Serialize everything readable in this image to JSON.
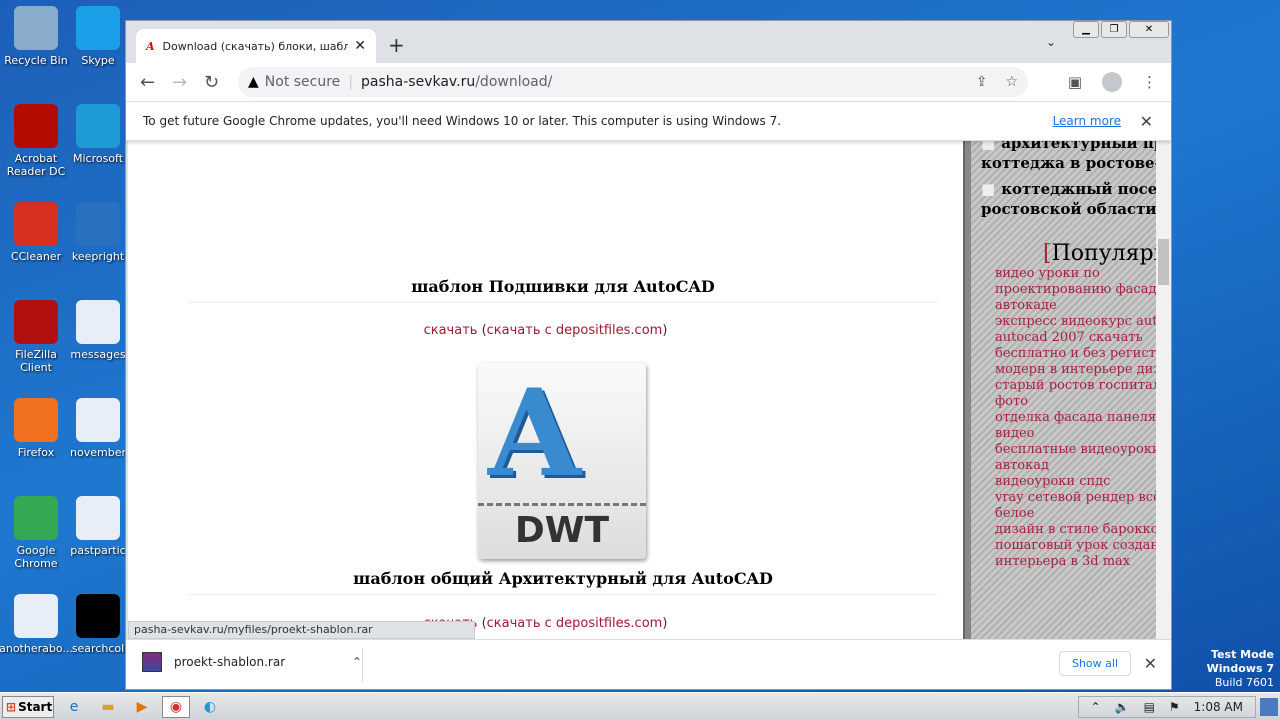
{
  "desktop": {
    "icons": [
      {
        "label": "Recycle Bin",
        "color": "#8aaccc"
      },
      {
        "label": "Skype",
        "color": "#1aa0e8"
      },
      {
        "label": "Acrobat Reader DC",
        "color": "#b30b00"
      },
      {
        "label": "Microsoft",
        "color": "#1e9ad6"
      },
      {
        "label": "CCleaner",
        "color": "#d83020"
      },
      {
        "label": "keepright",
        "color": "#2a70c0"
      },
      {
        "label": "FileZilla Client",
        "color": "#b01010"
      },
      {
        "label": "messages",
        "color": "#e8eef8"
      },
      {
        "label": "Firefox",
        "color": "#f07020"
      },
      {
        "label": "november",
        "color": "#e8eef8"
      },
      {
        "label": "Google Chrome",
        "color": "#34a853"
      },
      {
        "label": "pastpartic",
        "color": "#e8eef8"
      },
      {
        "label": "anotherabo...",
        "color": "#e8eef8"
      },
      {
        "label": "searchcol",
        "color": "#000000"
      }
    ]
  },
  "browser": {
    "tab": {
      "favicon": "A",
      "title": "Download (скачать) блоки, шаблоны"
    },
    "address": {
      "security": "Not secure",
      "host": "pasha-sevkav.ru",
      "path": "/download/"
    },
    "infobar": {
      "text": "To get future Google Chrome updates, you'll need Windows 10 or later. This computer is using Windows 7.",
      "link": "Learn more"
    },
    "status_url": "pasha-sevkav.ru/myfiles/proekt-shablon.rar",
    "download": {
      "file": "proekt-shablon.rar",
      "show_all": "Show all"
    }
  },
  "page": {
    "items": [
      {
        "title": "шаблон Подшивки для AutoCAD",
        "link1": "скачать",
        "link2": "скачать с depositfiles.com"
      },
      {
        "title": "шаблон общий Архитектурный для AutoCAD",
        "link1": "скачать",
        "link2": "скачать с depositfiles.com"
      }
    ],
    "file_icon_label": "DWT",
    "sidebar": {
      "bullets": [
        "архитектурный проект коттеджа в ростове-на-дону",
        "коттеджный поселок ростовской области."
      ],
      "popular_heading": "Популярное",
      "popular": [
        "видео уроки по",
        "проектированию фасадов в",
        "автокаде",
        "экспресс видеокурс autocad",
        "autocad 2007 скачать",
        "бесплатно и без регистрации",
        "модерн в интерьере дизайн",
        "старый ростов госпиталь",
        "фото",
        "отделка фасада панелями",
        "видео",
        "бесплатные видеоуроки",
        "автокад",
        "видеоуроки спдс",
        "vray сетевой рендер всё",
        "белое",
        "дизайн в стиле барокко",
        "пошаговый урок создания",
        "интерьера в 3d max"
      ]
    }
  },
  "watermark": {
    "line1": "Test Mode",
    "line2": "Windows 7",
    "line3": "Build 7601"
  },
  "taskbar": {
    "start": "Start",
    "clock": "1:08 AM"
  }
}
